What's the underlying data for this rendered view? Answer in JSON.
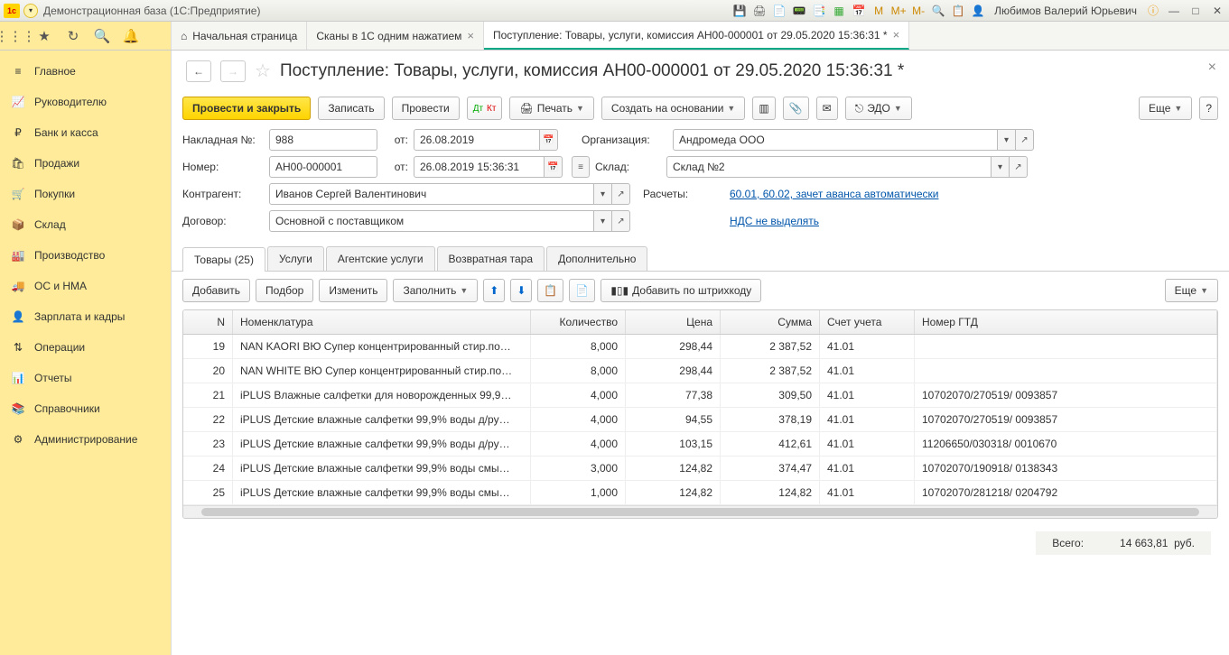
{
  "window": {
    "title": "Демонстрационная база  (1С:Предприятие)",
    "user": "Любимов Валерий Юрьевич"
  },
  "top_tabs": {
    "home": "Начальная страница",
    "scan": "Сканы в 1С одним нажатием",
    "doc": "Поступление: Товары, услуги, комиссия АН00-000001 от 29.05.2020 15:36:31 *"
  },
  "sidebar": [
    {
      "icon": "≡",
      "label": "Главное"
    },
    {
      "icon": "📈",
      "label": "Руководителю"
    },
    {
      "icon": "₽",
      "label": "Банк и касса"
    },
    {
      "icon": "🛍",
      "label": "Продажи"
    },
    {
      "icon": "🛒",
      "label": "Покупки"
    },
    {
      "icon": "📦",
      "label": "Склад"
    },
    {
      "icon": "🏭",
      "label": "Производство"
    },
    {
      "icon": "🚚",
      "label": "ОС и НМА"
    },
    {
      "icon": "👤",
      "label": "Зарплата и кадры"
    },
    {
      "icon": "⇅",
      "label": "Операции"
    },
    {
      "icon": "📊",
      "label": "Отчеты"
    },
    {
      "icon": "📚",
      "label": "Справочники"
    },
    {
      "icon": "⚙",
      "label": "Администрирование"
    }
  ],
  "page": {
    "title": "Поступление: Товары, услуги, комиссия АН00-000001 от 29.05.2020 15:36:31 *",
    "buttons": {
      "post_close": "Провести и закрыть",
      "record": "Записать",
      "post": "Провести",
      "print": "Печать",
      "create_based": "Создать на основании",
      "edo": "ЭДО",
      "more": "Еще"
    },
    "form": {
      "invoice_no_label": "Накладная  №:",
      "invoice_no": "988",
      "from_label": "от:",
      "invoice_date": "26.08.2019",
      "number_label": "Номер:",
      "number": "АН00-000001",
      "number_date": "26.08.2019 15:36:31",
      "org_label": "Организация:",
      "org": "Андромеда ООО",
      "warehouse_label": "Склад:",
      "warehouse": "Склад №2",
      "contractor_label": "Контрагент:",
      "contractor": "Иванов Сергей Валентинович",
      "calc_label": "Расчеты:",
      "calc_link": "60.01, 60.02, зачет аванса автоматически",
      "contract_label": "Договор:",
      "contract": "Основной с поставщиком",
      "vat_link": "НДС не выделять"
    },
    "doc_tabs": {
      "goods": "Товары (25)",
      "services": "Услуги",
      "agent": "Агентские услуги",
      "return": "Возвратная тара",
      "extra": "Дополнительно"
    },
    "table_toolbar": {
      "add": "Добавить",
      "pick": "Подбор",
      "edit": "Изменить",
      "fill": "Заполнить",
      "barcode": "Добавить по штрихкоду",
      "more": "Еще"
    },
    "columns": {
      "n": "N",
      "nom": "Номенклатура",
      "qty": "Количество",
      "price": "Цена",
      "sum": "Сумма",
      "acc": "Счет учета",
      "gtd": "Номер ГТД"
    },
    "rows": [
      {
        "n": "19",
        "nom": "NAN KAORI ВЮ Супер концентрированный стир.по…",
        "qty": "8,000",
        "price": "298,44",
        "sum": "2 387,52",
        "acc": "41.01",
        "gtd": ""
      },
      {
        "n": "20",
        "nom": "NAN WHITE ВЮ Супер концентрированный стир.по…",
        "qty": "8,000",
        "price": "298,44",
        "sum": "2 387,52",
        "acc": "41.01",
        "gtd": ""
      },
      {
        "n": "21",
        "nom": "iPLUS Влажные салфетки для новорожденных 99,9…",
        "qty": "4,000",
        "price": "77,38",
        "sum": "309,50",
        "acc": "41.01",
        "gtd": "10702070/270519/ 0093857"
      },
      {
        "n": "22",
        "nom": "iPLUS Детские влажные салфетки 99,9% воды д/ру…",
        "qty": "4,000",
        "price": "94,55",
        "sum": "378,19",
        "acc": "41.01",
        "gtd": "10702070/270519/ 0093857"
      },
      {
        "n": "23",
        "nom": "iPLUS Детские влажные салфетки 99,9% воды д/ру…",
        "qty": "4,000",
        "price": "103,15",
        "sum": "412,61",
        "acc": "41.01",
        "gtd": "11206650/030318/ 0010670"
      },
      {
        "n": "24",
        "nom": "iPLUS Детские влажные салфетки 99,9% воды смы…",
        "qty": "3,000",
        "price": "124,82",
        "sum": "374,47",
        "acc": "41.01",
        "gtd": "10702070/190918/ 0138343"
      },
      {
        "n": "25",
        "nom": "iPLUS Детские влажные салфетки 99,9% воды смы…",
        "qty": "1,000",
        "price": "124,82",
        "sum": "124,82",
        "acc": "41.01",
        "gtd": "10702070/281218/ 0204792"
      }
    ],
    "total": {
      "label": "Всего:",
      "value": "14 663,81",
      "currency": "руб."
    }
  }
}
